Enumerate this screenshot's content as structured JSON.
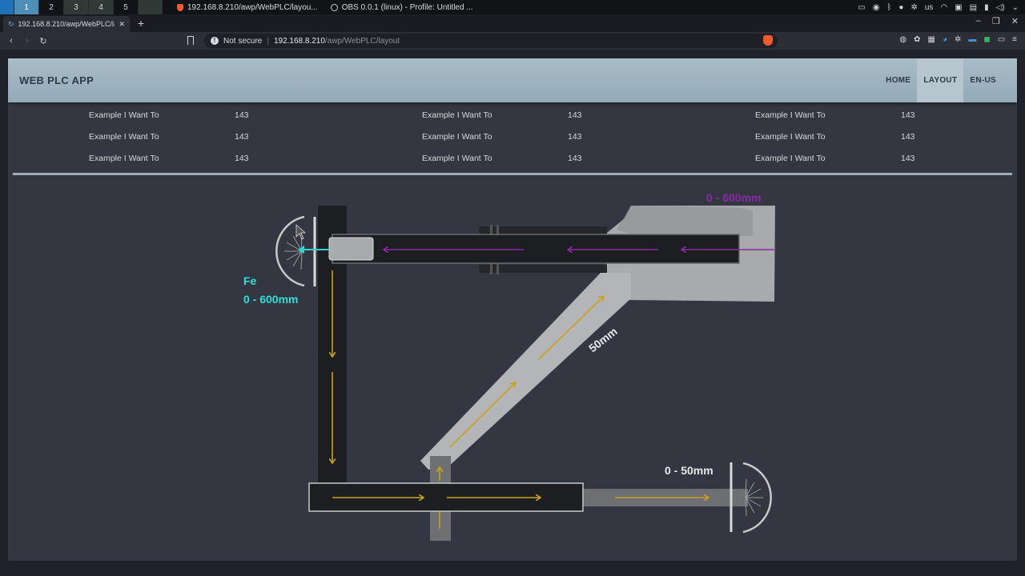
{
  "taskbar": {
    "workspaces": [
      "1",
      "2",
      "3",
      "4",
      "5"
    ],
    "tasks": [
      {
        "title": "192.168.8.210/awp/WebPLC/layou..."
      },
      {
        "title": "OBS 0.0.1 (linux) - Profile: Untitled ..."
      }
    ],
    "tray_locale": "us"
  },
  "browser": {
    "tab_title": "192.168.8.210/awp/WebPLC/la",
    "security_label": "Not secure",
    "url_host": "192.168.8.210",
    "url_path": "/awp/WebPLC/layout"
  },
  "app": {
    "brand": "WEB PLC APP",
    "nav": [
      {
        "label": "HOME",
        "active": false
      },
      {
        "label": "LAYOUT",
        "active": true
      },
      {
        "label": "EN-US",
        "active": false
      }
    ],
    "table": {
      "rows": [
        [
          "Example I Want To",
          "143",
          "Example I Want To",
          "143",
          "Example I Want To",
          "143"
        ],
        [
          "Example I Want To",
          "143",
          "Example I Want To",
          "143",
          "Example I Want To",
          "143"
        ],
        [
          "Example I Want To",
          "143",
          "Example I Want To",
          "143",
          "Example I Want To",
          "143"
        ]
      ]
    },
    "diagram": {
      "fe_label": "Fe",
      "fe_range": "0 - 600mm",
      "top_range": "0 - 600mm",
      "diag_label": "50mm",
      "bottom_range": "0 - 50mm",
      "colors": {
        "arrow_yellow": "#c9a21a",
        "arrow_purple": "#8a2aa6",
        "arrow_cyan": "#2ed6d0",
        "fe_text": "#2ee0d8"
      }
    }
  }
}
